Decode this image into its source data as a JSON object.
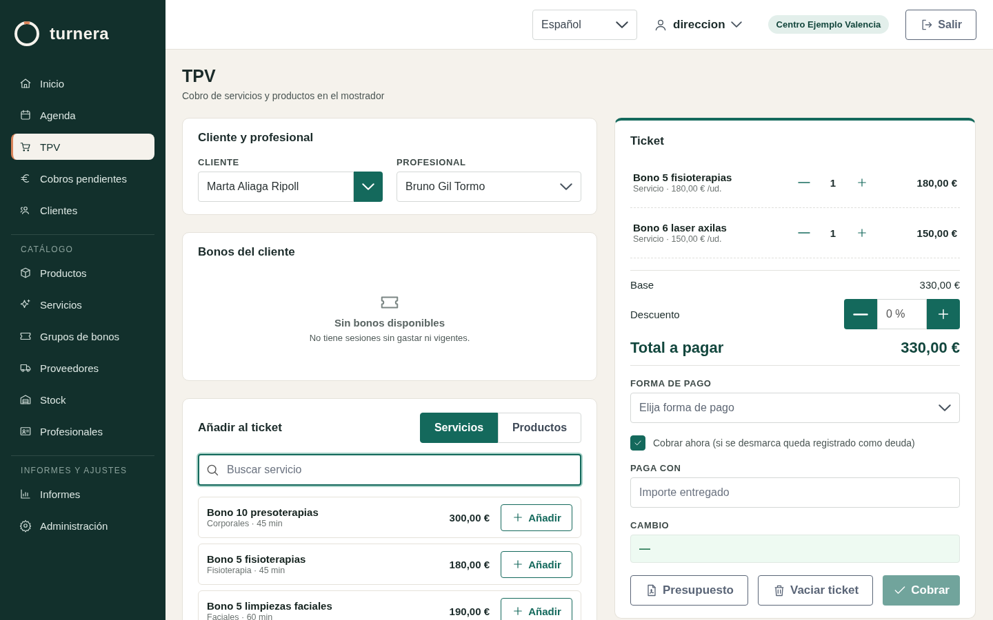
{
  "sidebar": {
    "brand": "turnera",
    "sections": [
      {
        "items": [
          {
            "label": "Inicio",
            "selected": false
          },
          {
            "label": "Agenda",
            "selected": false
          },
          {
            "label": "TPV",
            "selected": true
          },
          {
            "label": "Cobros pendientes",
            "selected": false
          },
          {
            "label": "Clientes",
            "selected": false
          }
        ]
      },
      {
        "heading": "CATÁLOGO",
        "items": [
          {
            "label": "Productos",
            "selected": false
          },
          {
            "label": "Servicios",
            "selected": false
          },
          {
            "label": "Grupos de bonos",
            "selected": false
          },
          {
            "label": "Proveedores",
            "selected": false
          },
          {
            "label": "Stock",
            "selected": false
          },
          {
            "label": "Profesionales",
            "selected": false
          }
        ]
      },
      {
        "heading": "INFORMES Y AJUSTES",
        "items": [
          {
            "label": "Informes",
            "selected": false
          },
          {
            "label": "Administración",
            "selected": false
          }
        ]
      }
    ]
  },
  "header": {
    "language": "Español",
    "user": "direccion",
    "center": "Centro Ejemplo Valencia",
    "logout": "Salir"
  },
  "page": {
    "title": "TPV",
    "subtitle": "Cobro de servicios y productos en el mostrador"
  },
  "client_card": {
    "title": "Cliente y profesional",
    "fields": [
      {
        "label": "CLIENTE",
        "value": "Marta Aliaga Ripoll",
        "kind": "combo"
      },
      {
        "label": "PROFESIONAL",
        "value": "Bruno Gil Tormo",
        "kind": "select"
      }
    ]
  },
  "bonos_card": {
    "title": "Bonos del cliente",
    "empty_title": "Sin bonos disponibles",
    "empty_text": "No tiene sesiones sin gastar ni vigentes."
  },
  "add_card": {
    "title": "Añadir al ticket",
    "tabs": [
      {
        "label": "Servicios",
        "selected": true
      },
      {
        "label": "Productos",
        "selected": false
      }
    ],
    "search": {
      "placeholder": "Buscar servicio"
    },
    "items": [
      {
        "name": "Bono 10 presoterapias",
        "meta": "Corporales · 45 min",
        "price": "300,00 €",
        "button": "Añadir"
      },
      {
        "name": "Bono 5 fisioterapias",
        "meta": "Fisioterapia · 45 min",
        "price": "180,00 €",
        "button": "Añadir"
      },
      {
        "name": "Bono 5 limpiezas faciales",
        "meta": "Faciales · 60 min",
        "price": "190,00 €",
        "button": "Añadir"
      }
    ]
  },
  "ticket": {
    "title": "Ticket",
    "lines": [
      {
        "name": "Bono 5 fisioterapias",
        "meta": "Servicio · 180,00 € /ud.",
        "quantity": "1",
        "total": "180,00 €"
      },
      {
        "name": "Bono 6 laser axilas",
        "meta": "Servicio · 150,00 € /ud.",
        "quantity": "1",
        "total": "150,00 €"
      }
    ],
    "base_label": "Base",
    "base_value": "330,00 €",
    "discount_label": "Descuento",
    "discount_value": "0 %",
    "total_label": "Total a pagar",
    "total_value": "330,00 €",
    "payment_label": "FORMA DE PAGO",
    "payment_placeholder": "Elija forma de pago",
    "charge_now": {
      "label": "Cobrar ahora (si se desmarca queda registrado como deuda)",
      "checked": true
    },
    "paid_label": "PAGA CON",
    "paid_placeholder": "Importe entregado",
    "change_label": "CAMBIO",
    "change_value": "—",
    "buttons": [
      {
        "label": "Presupuesto",
        "kind": "document",
        "disabled": false
      },
      {
        "label": "Vaciar ticket",
        "kind": "trash",
        "disabled": false
      },
      {
        "label": "Cobrar",
        "kind": "check",
        "disabled": true
      }
    ]
  }
}
